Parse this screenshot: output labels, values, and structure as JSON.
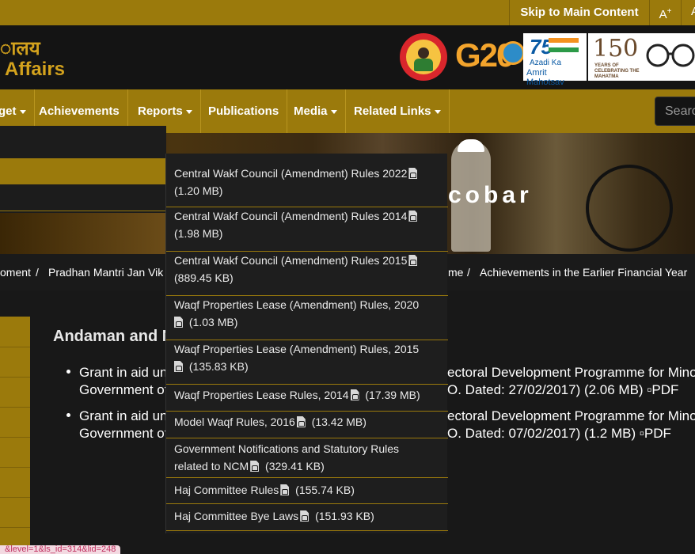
{
  "topbar": {
    "skip_label": "Skip to Main Content",
    "font_increase": "A",
    "font_increase_sup": "+",
    "font_decrease": "A"
  },
  "header": {
    "ministry_hindi": "ालय",
    "ministry_english": "Affairs",
    "logos": [
      "beti-bachao-logo",
      "g20-logo",
      "azadi-ka-amrit-mahotsav-logo",
      "mahatma-150-logo",
      "swachh-bharat-logo"
    ],
    "azadi_number": "75",
    "azadi_line1": "Azadi Ka",
    "azadi_line2": "Amrit Mahotsav",
    "g20_text": "G20",
    "mahatma_number": "150",
    "mahatma_text": "YEARS OF CELEBRATING THE MAHATMA"
  },
  "nav": {
    "items": [
      {
        "label": "get",
        "has_caret": true
      },
      {
        "label": "Achievements",
        "has_caret": false
      },
      {
        "label": "Reports",
        "has_caret": true
      },
      {
        "label": "Publications",
        "has_caret": false
      },
      {
        "label": "Media",
        "has_caret": true
      },
      {
        "label": "Related Links",
        "has_caret": true
      }
    ],
    "search_placeholder": "Searc"
  },
  "banner": {
    "title_fragment": "cobar"
  },
  "breadcrumb": {
    "items": [
      "oment",
      "Pradhan Mantri Jan Vik",
      "me",
      "Achievements in the Earlier Financial Year"
    ],
    "separator": "/"
  },
  "content": {
    "heading": "Andaman and N",
    "bullets": [
      {
        "line1_left": "Grant in aid un",
        "line1_right": "ectoral Development Programme for Minor",
        "line2_left": "Government of",
        "line2_right": "O. Dated: 27/02/2017) (2.06 MB)",
        "pdf_alt": "PDF"
      },
      {
        "line1_left": "Grant in aid un",
        "line1_right": "ectoral Development Programme for Minor",
        "line2_left": "Government of",
        "line2_right": "O. Dated: 07/02/2017) (1.2 MB)",
        "pdf_alt": "PDF"
      }
    ]
  },
  "dropdown": {
    "items": [
      {
        "line1": "Central Wakf Council (Amendment) Rules 2022",
        "line2": "(1.20 MB)"
      },
      {
        "line1": "Central Wakf Council (Amendment) Rules 2014",
        "line2": "(1.98 MB)"
      },
      {
        "line1": "Central Wakf Council (Amendment) Rules 2015",
        "line2": "(889.45 KB)"
      },
      {
        "line1": "Waqf Properties Lease (Amendment) Rules, 2020",
        "line2": "(1.03 MB)"
      },
      {
        "line1": "Waqf Properties Lease (Amendment) Rules, 2015",
        "line2": "(135.83 KB)"
      },
      {
        "line1": "Waqf Properties Lease Rules, 2014",
        "size": "(17.39 MB)"
      },
      {
        "line1": "Model Waqf Rules, 2016",
        "size": "(13.42 MB)"
      },
      {
        "line1": "Government Notifications and Statutory Rules",
        "line2a": "related to NCM",
        "line2": "(329.41 KB)"
      },
      {
        "line1": "Haj Committee Rules",
        "size": "(155.74 KB)"
      },
      {
        "line1": "Haj Committee Bye Laws",
        "size": "(151.93 KB)"
      }
    ]
  },
  "status_bar": {
    "url_fragment": "&level=1&ls_id=314&lid=248"
  },
  "colors": {
    "accent": "#9b7a0c",
    "header_bg": "#141414",
    "gold_text": "#d3a21d"
  }
}
